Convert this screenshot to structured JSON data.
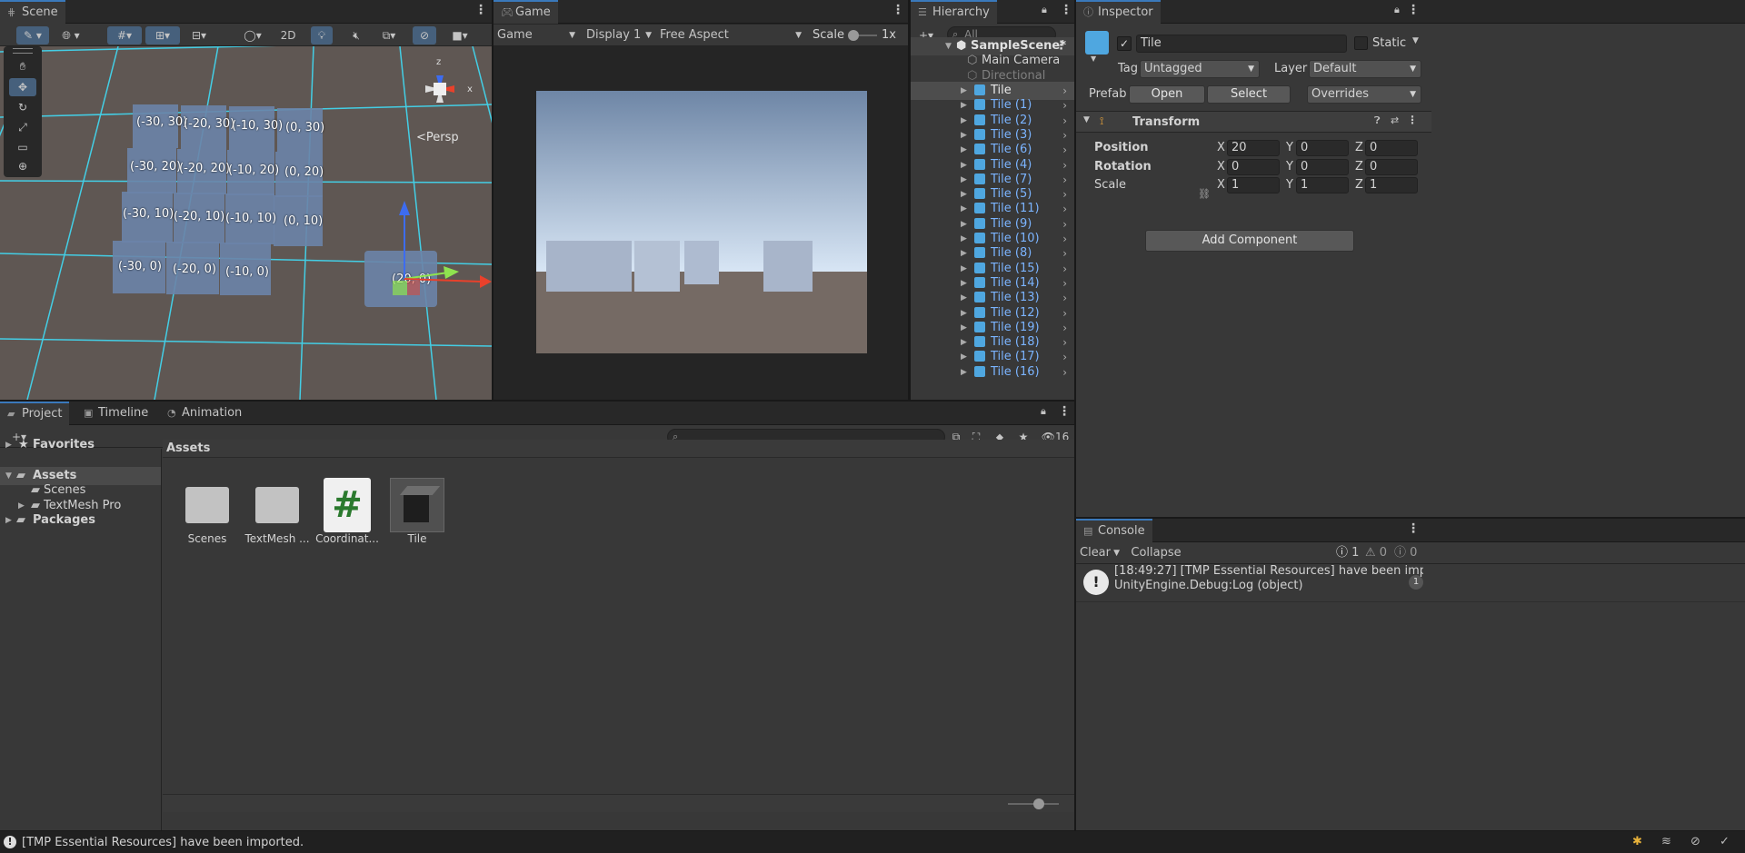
{
  "scene": {
    "tab": "Scene",
    "btn_2d": "2D",
    "persp_label": "<Persp",
    "gizmo_labels": {
      "x": "x",
      "y": "y",
      "z": "z"
    },
    "tiles": [
      "(-30, 30)",
      "(-20, 30)",
      "(-10, 30)",
      "(0, 30)",
      "(-30, 20)",
      "(-20, 20)",
      "(-10, 20)",
      "(0, 20)",
      "(-30, 10)",
      "(-20, 10)",
      "(-10, 10)",
      "(0, 10)",
      "(-30, 0)",
      "(-20, 0)",
      "(-10, 0)",
      "(20, 0)"
    ]
  },
  "game": {
    "tab": "Game",
    "mode": "Game",
    "display": "Display 1",
    "aspect": "Free Aspect",
    "scale_label": "Scale",
    "scale_value": "1x",
    "sky_top": "#6e86a6",
    "sky_horizon": "#d8e6f5",
    "ground": "#756a64"
  },
  "hierarchy": {
    "tab": "Hierarchy",
    "search_placeholder": "All",
    "scene_name": "SampleScene*",
    "items": [
      "Main Camera",
      "Directional Light"
    ],
    "tiles": [
      "Tile",
      "Tile (1)",
      "Tile (2)",
      "Tile (3)",
      "Tile (6)",
      "Tile (4)",
      "Tile (7)",
      "Tile (5)",
      "Tile (11)",
      "Tile (9)",
      "Tile (10)",
      "Tile (8)",
      "Tile (15)",
      "Tile (14)",
      "Tile (13)",
      "Tile (12)",
      "Tile (19)",
      "Tile (18)",
      "Tile (17)",
      "Tile (16)"
    ]
  },
  "inspector": {
    "tab": "Inspector",
    "name": "Tile",
    "static_label": "Static",
    "tag_label": "Tag",
    "tag_value": "Untagged",
    "layer_label": "Layer",
    "layer_value": "Default",
    "prefab_label": "Prefab",
    "open": "Open",
    "select": "Select",
    "overrides": "Overrides",
    "component": "Transform",
    "rows": [
      {
        "label": "Position",
        "x": "20",
        "y": "0",
        "z": "0"
      },
      {
        "label": "Rotation",
        "x": "0",
        "y": "0",
        "z": "0"
      },
      {
        "label": "Scale",
        "x": "1",
        "y": "1",
        "z": "1"
      }
    ],
    "axis": {
      "x": "X",
      "y": "Y",
      "z": "Z"
    },
    "add_component": "Add Component"
  },
  "console": {
    "tab": "Console",
    "clear": "Clear",
    "collapse": "Collapse",
    "info_count": "1",
    "warn_count": "0",
    "error_count": "0",
    "msg_line1": "[18:49:27] [TMP Essential Resources] have been imported.",
    "msg_line2": "UnityEngine.Debug:Log (object)",
    "msg_count": "1"
  },
  "project": {
    "tabs": [
      "Project",
      "Timeline",
      "Animation"
    ],
    "hidden_count": "16",
    "tree": {
      "favorites": "Favorites",
      "assets": "Assets",
      "scenes": "Scenes",
      "textmesh": "TextMesh Pro",
      "packages": "Packages"
    },
    "breadcrumb": "Assets",
    "assets": [
      "Scenes",
      "TextMesh ...",
      "Coordinat...",
      "Tile"
    ]
  },
  "status": {
    "message": "[TMP Essential Resources] have been imported."
  }
}
